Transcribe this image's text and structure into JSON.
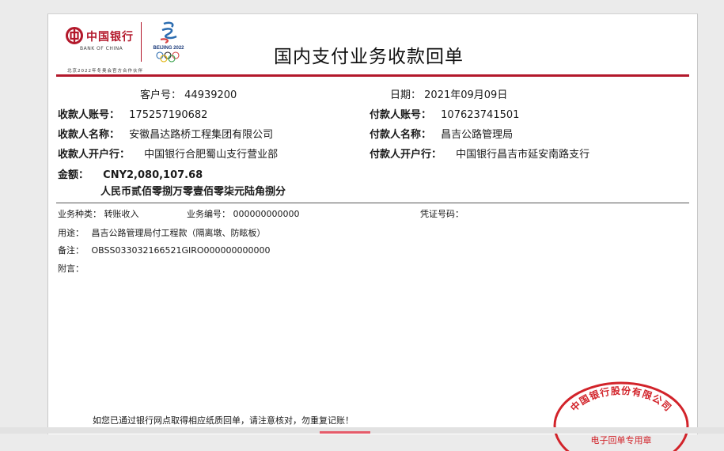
{
  "header": {
    "bank_cn": "中国银行",
    "bank_en": "BANK OF CHINA",
    "games_label": "BEIJING 2022",
    "partner_text": "北京2022年冬奥会官方合作伙伴",
    "title": "国内支付业务收款回单"
  },
  "info": {
    "customer_label": "客户号：",
    "customer_no": "44939200",
    "date_label": "日期：",
    "date": "2021年09月09日",
    "payee_account_label": "收款人账号：",
    "payee_account": "175257190682",
    "payer_account_label": "付款人账号：",
    "payer_account": "107623741501",
    "payee_name_label": "收款人名称：",
    "payee_name": "安徽昌达路桥工程集团有限公司",
    "payer_name_label": "付款人名称：",
    "payer_name": "昌吉公路管理局",
    "payee_bank_label": "收款人开户行：",
    "payee_bank": "中国银行合肥蜀山支行营业部",
    "payer_bank_label": "付款人开户行：",
    "payer_bank": "中国银行昌吉市延安南路支行",
    "amount_label": "金额：",
    "amount": "CNY2,080,107.68",
    "amount_words": "人民币贰佰零捌万零壹佰零柒元陆角捌分"
  },
  "details": {
    "biz_type_label": "业务种类：",
    "biz_type": "转账收入",
    "biz_no_label": "业务编号：",
    "biz_no": "000000000000",
    "voucher_label": "凭证号码：",
    "voucher": "",
    "purpose_label": "用途：",
    "purpose": "昌吉公路管理局付工程款（隔离墩、防眩板）",
    "remark_label": "备注：",
    "remark": "OBSS033032166521GIRO000000000000",
    "note_label": "附言："
  },
  "footer": {
    "notice": "如您已通过银行网点取得相应纸质回单，请注意核对，勿重复记账！"
  },
  "stamp": {
    "text_top": "中国银行股份有限公司",
    "text_bottom": "电子回单专用章"
  },
  "colors": {
    "brand_red": "#b3182b",
    "stamp_red": "#d2232a"
  }
}
